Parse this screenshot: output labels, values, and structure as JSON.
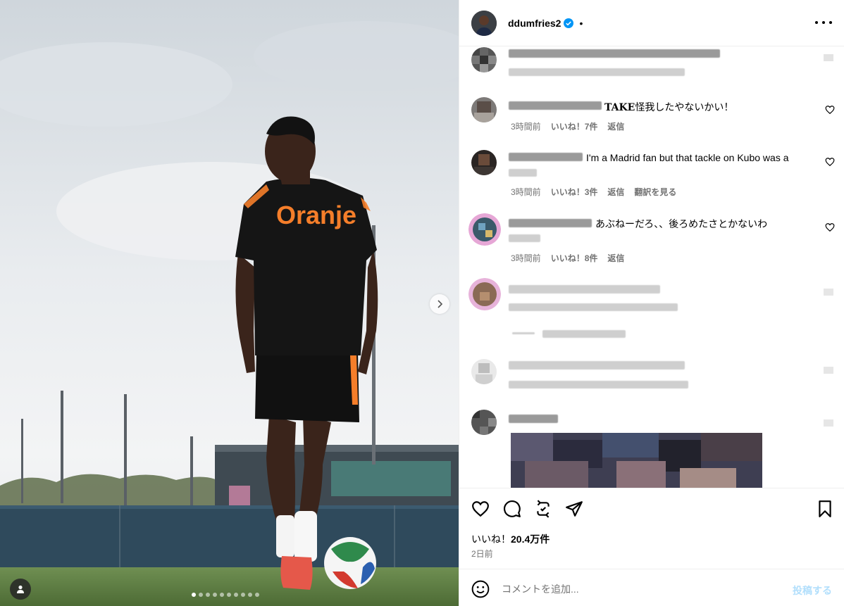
{
  "post": {
    "username": "ddumfries2",
    "separator": "•"
  },
  "media": {
    "shirt_text": "Oranje",
    "total_slides": 10,
    "active_slide": 1
  },
  "comments": [
    {
      "text": "",
      "time": "",
      "likes": "",
      "reply": "",
      "translate": ""
    },
    {
      "bold": "TAKE",
      "text": "怪我したやないかい！",
      "time": "3時間前",
      "likes": "いいね！7件",
      "reply": "返信",
      "translate": ""
    },
    {
      "text": "I'm a Madrid fan but that tackle on Kubo was a",
      "time": "3時間前",
      "likes": "いいね！3件",
      "reply": "返信",
      "translate": "翻訳を見る"
    },
    {
      "text": "あぶねーだろ、、後ろめたさとかないわ",
      "time": "3時間前",
      "likes": "いいね！8件",
      "reply": "返信",
      "translate": ""
    }
  ],
  "actions": {
    "likes_label": "いいね！",
    "likes_count": "20.4万件",
    "time_ago": "2日前"
  },
  "composer": {
    "placeholder": "コメントを追加...",
    "post_label": "投稿する"
  },
  "colors": {
    "accent": "#0095f6",
    "post_disabled": "#b2dffc",
    "jersey_orange": "#f57e2a"
  },
  "icons": [
    "verified-icon",
    "more-icon",
    "chevron-right-icon",
    "user-tag-icon",
    "heart-icon",
    "comment-icon",
    "repost-icon",
    "share-icon",
    "bookmark-icon",
    "emoji-icon"
  ]
}
